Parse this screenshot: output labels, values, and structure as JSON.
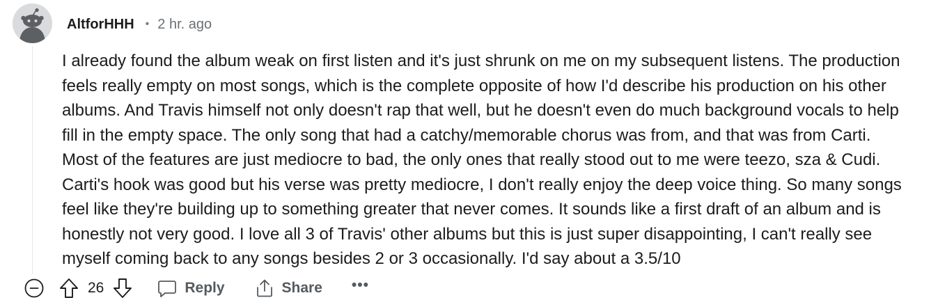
{
  "comment": {
    "author": "AltforHHH",
    "separator": "•",
    "timestamp": "2 hr. ago",
    "avatar_icon": "reddit-snoo-avatar-icon",
    "body_lines": [
      "I already found the album weak on first listen and it's just shrunk on me on my subsequent listens. The production",
      "feels really empty on most songs, which is the complete opposite of how I'd describe his production on his other",
      "albums. And Travis himself not only doesn't rap that well, but he doesn't even do much background vocals to help",
      "fill in the empty space. The only song that had a catchy/memorable chorus was from, and that was from Carti.",
      "Most of the features are just mediocre to bad, the only ones that really stood out to me were teezo, sza & Cudi.",
      "Carti's hook was good but his verse was pretty mediocre, I don't really enjoy the deep voice thing. So many songs",
      "feel like they're building up to something greater that never comes. It sounds like a first draft of an album and is",
      "honestly not very good. I love all 3 of Travis' other albums but this is just super disappointing, I can't really see",
      "myself coming back to any songs besides 2 or 3 occasionally. I'd say about a 3.5/10"
    ]
  },
  "actions": {
    "score": "26",
    "reply_label": "Reply",
    "share_label": "Share",
    "more_label": "•••",
    "icons": {
      "collapse": "collapse-minus-icon",
      "upvote": "upvote-arrow-icon",
      "downvote": "downvote-arrow-icon",
      "reply": "reply-bubble-icon",
      "share": "share-icon",
      "more": "more-options-icon"
    }
  },
  "colors": {
    "text": "#1c1c1c",
    "muted": "#6b6f73",
    "action": "#555a5e",
    "avatar_bg": "#d9dbdc",
    "thread_line": "#e5e7ea"
  }
}
